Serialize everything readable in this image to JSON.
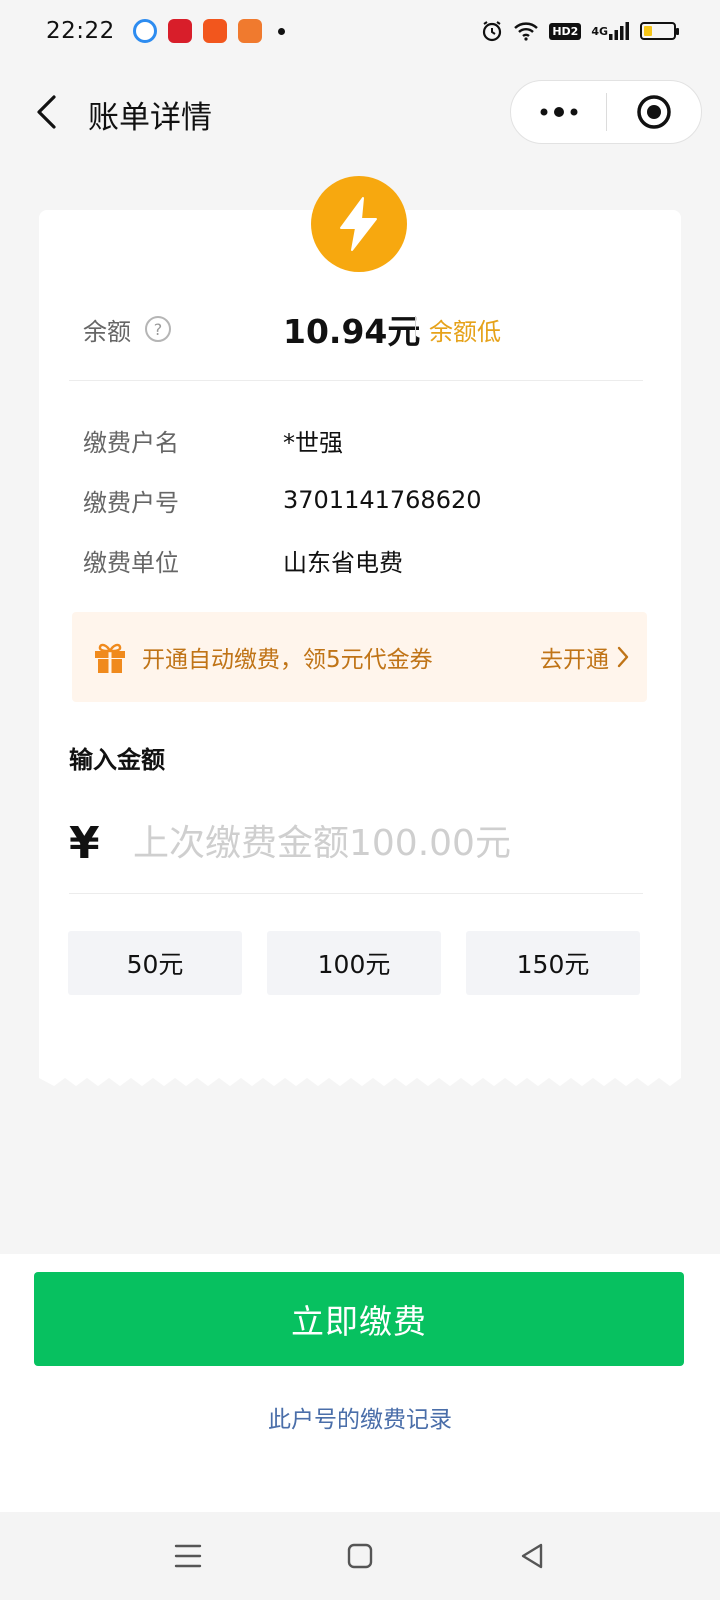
{
  "status_bar": {
    "time": "22:22",
    "network": "4G",
    "hd": "HD2"
  },
  "header": {
    "title": "账单详情"
  },
  "balance": {
    "label": "余额",
    "help": "?",
    "value": "10.94元",
    "tag": "余额低"
  },
  "account": [
    {
      "label": "缴费户名",
      "value": "*世强"
    },
    {
      "label": "缴费户号",
      "value": "3701141768620"
    },
    {
      "label": "缴费单位",
      "value": "山东省电费"
    }
  ],
  "promo": {
    "text": "开通自动缴费，领5元代金券",
    "action": "去开通"
  },
  "amount": {
    "title": "输入金额",
    "currency": "¥",
    "placeholder": "上次缴费金额100.00元",
    "value": ""
  },
  "quick_amounts": [
    "50元",
    "100元",
    "150元"
  ],
  "pay_button": "立即缴费",
  "records_link": "此户号的缴费记录",
  "colors": {
    "accent": "#07c160",
    "warning": "#f7a80f",
    "promo_text": "#c07417",
    "link": "#4a6ea9"
  }
}
